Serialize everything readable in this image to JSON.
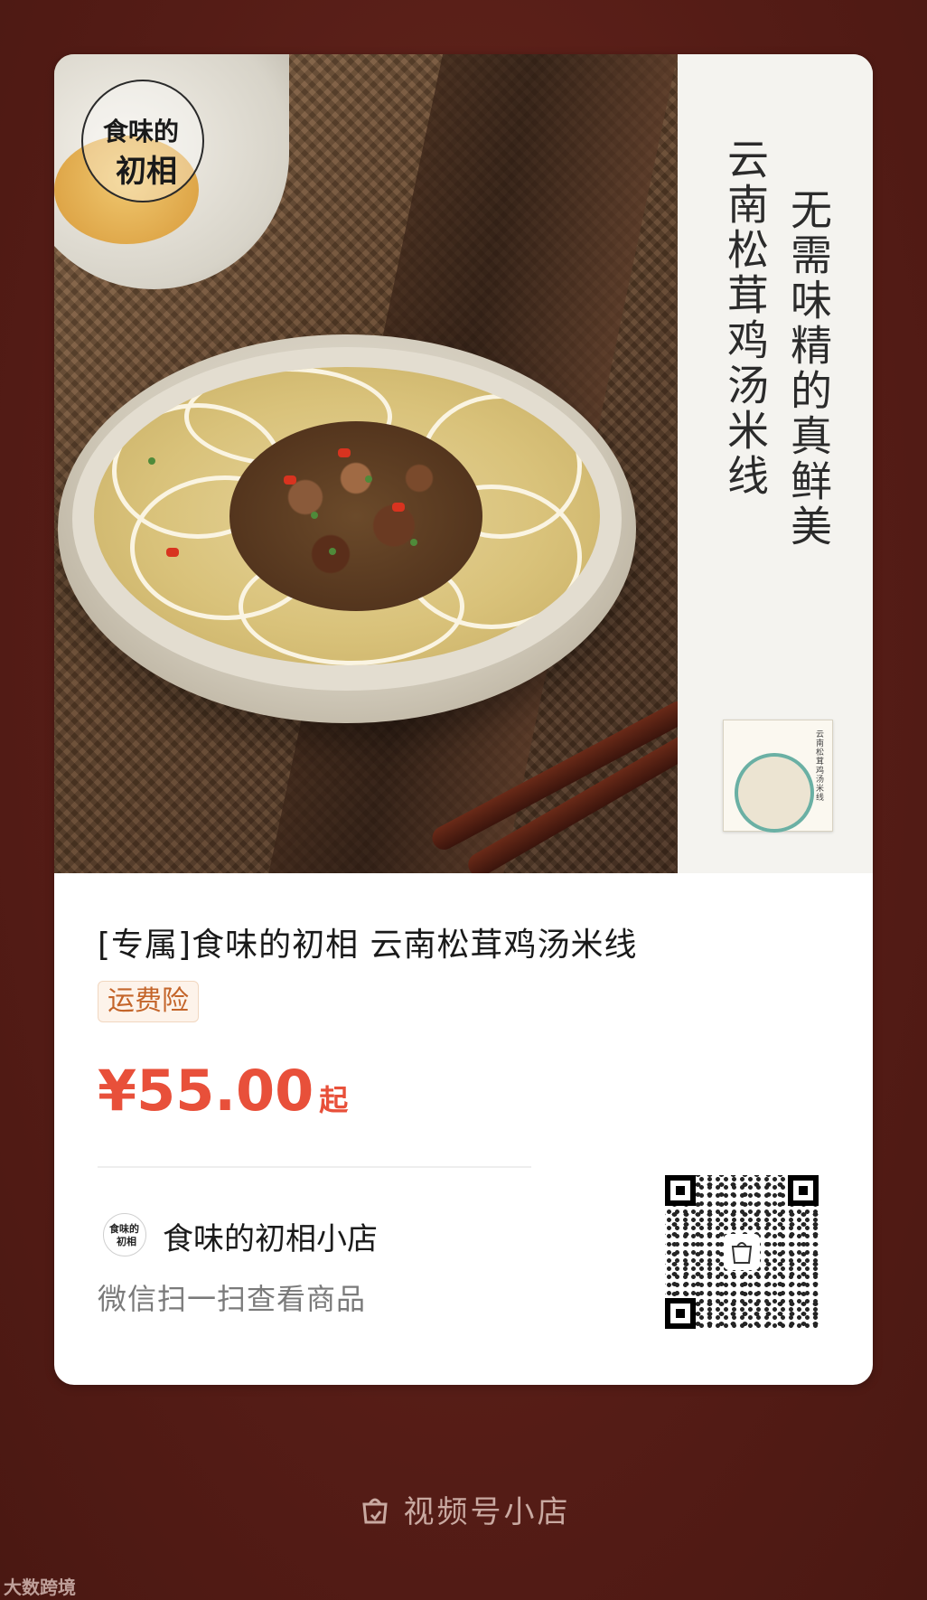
{
  "hero": {
    "logo_line1": "食味的",
    "logo_line2": "初相",
    "slogan_right": "无需味精的真鲜美",
    "slogan_left": "云南松茸鸡汤米线",
    "package_text": "云南松茸鸡汤米线"
  },
  "product": {
    "title": "[专属]食味的初相 云南松茸鸡汤米线",
    "tag": "运费险",
    "price": "¥55.00",
    "price_suffix": "起"
  },
  "shop": {
    "avatar_line1": "食味的",
    "avatar_line2": "初相",
    "name": "食味的初相小店",
    "scan_hint": "微信扫一扫查看商品"
  },
  "footer": {
    "brand": "视频号小店",
    "watermark": "大数跨境"
  },
  "colors": {
    "background": "#5a1f18",
    "price": "#e8503a",
    "tag": "#c4652a"
  },
  "icons": [
    "shop-bag-icon",
    "qr-code",
    "logo-badge"
  ]
}
